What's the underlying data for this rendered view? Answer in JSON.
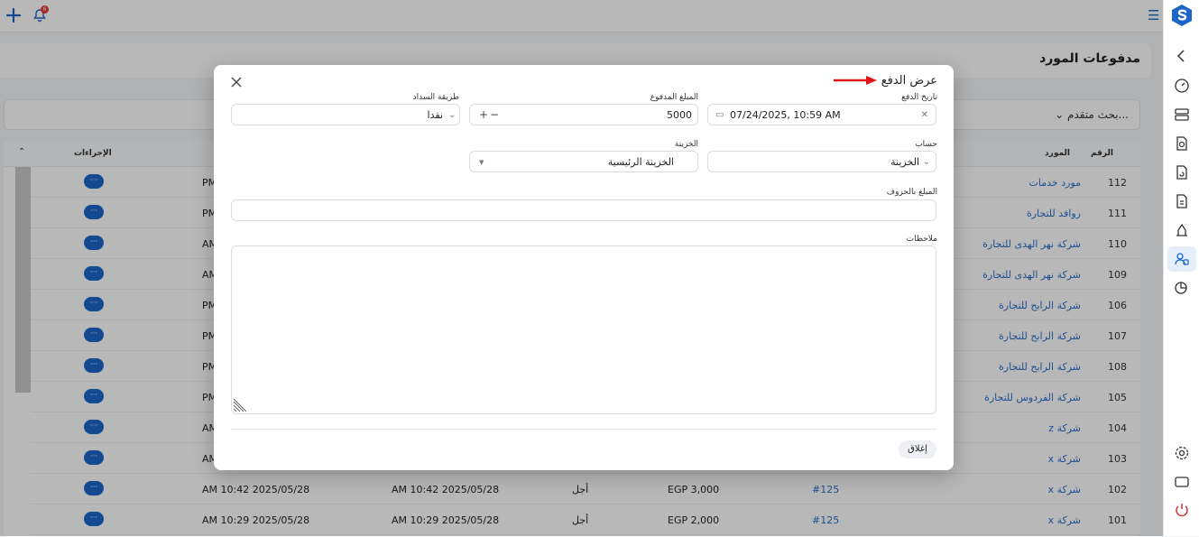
{
  "topbar": {
    "notification_count": "6"
  },
  "page": {
    "title": "مدفوعات المورد",
    "advanced_search": "بحث متقدم..."
  },
  "table": {
    "headers": {
      "number": "الرقم",
      "supplier": "المورد",
      "actions": "الإجراءات"
    },
    "action_label": "···",
    "rows": [
      {
        "number": "112",
        "supplier": "مورد خدمات",
        "date1": "PM",
        "date2": "",
        "type": "",
        "amount": "",
        "ref": ""
      },
      {
        "number": "111",
        "supplier": "روافد للتجارة",
        "date1": "PM",
        "date2": "",
        "type": "",
        "amount": "",
        "ref": ""
      },
      {
        "number": "110",
        "supplier": "شركة نهر الهدى للتجارة",
        "date1": "AM",
        "date2": "",
        "type": "",
        "amount": "",
        "ref": ""
      },
      {
        "number": "109",
        "supplier": "شركة نهر الهدى للتجارة",
        "date1": "AM",
        "date2": "",
        "type": "",
        "amount": "",
        "ref": ""
      },
      {
        "number": "106",
        "supplier": "شركة الرابح للتجارة",
        "date1": "PM",
        "date2": "",
        "type": "",
        "amount": "",
        "ref": ""
      },
      {
        "number": "107",
        "supplier": "شركة الرابح للتجارة",
        "date1": "PM",
        "date2": "",
        "type": "",
        "amount": "",
        "ref": ""
      },
      {
        "number": "108",
        "supplier": "شركة الرابح للتجارة",
        "date1": "PM",
        "date2": "",
        "type": "",
        "amount": "",
        "ref": ""
      },
      {
        "number": "105",
        "supplier": "شركة الفردوس للتجارة",
        "date1": "PM",
        "date2": "",
        "type": "",
        "amount": "",
        "ref": ""
      },
      {
        "number": "104",
        "supplier": "شركة z",
        "date1": "AM",
        "date2": "",
        "type": "",
        "amount": "",
        "ref": ""
      },
      {
        "number": "103",
        "supplier": "شركة x",
        "date1": "AM",
        "date2": "",
        "type": "",
        "amount": "",
        "ref": ""
      },
      {
        "number": "102",
        "supplier": "شركة x",
        "date1": "AM 10:42 2025/05/28",
        "date2": "AM 10:42 2025/05/28",
        "type": "أجل",
        "amount": "EGP 3,000",
        "ref": "#125"
      },
      {
        "number": "101",
        "supplier": "شركة x",
        "date1": "AM 10:29 2025/05/28",
        "date2": "AM 10:29 2025/05/28",
        "type": "أجل",
        "amount": "EGP 2,000",
        "ref": "#125"
      }
    ]
  },
  "modal": {
    "title": "عرض الدفع",
    "payment_date_label": "تاريخ الدفع",
    "payment_date_value": "07/24/2025, 10:59 AM",
    "amount_paid_label": "المبلغ المدفوع",
    "amount_paid_value": "5000",
    "payment_method_label": "طريقة السداد",
    "payment_method_value": "نقدا",
    "account_label": "حساب",
    "account_value": "الخزينة",
    "treasury_label": "الخزينة",
    "treasury_value": "الخزينة الرئيسية",
    "amount_words_label": "المبلغ بالحروف",
    "amount_words_value": "",
    "notes_label": "ملاحظات",
    "notes_value": "",
    "close_button": "إغلاق"
  },
  "colors": {
    "accent": "#1b66c9",
    "link": "#2a6fc9",
    "arrow": "#e0141b"
  }
}
